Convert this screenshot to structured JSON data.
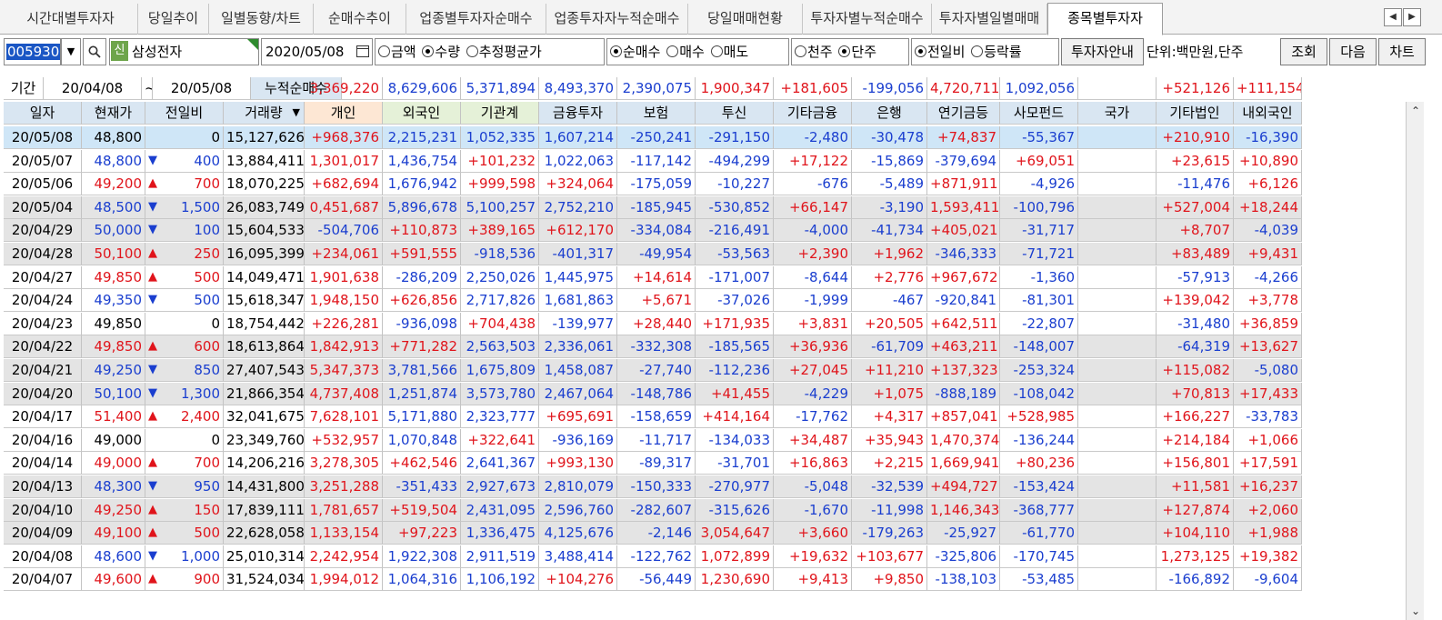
{
  "tabs": [
    "시간대별투자자",
    "당일추이",
    "일별동향/차트",
    "순매수추이",
    "업종별투자자순매수",
    "업종투자자누적순매수",
    "당일매매현황",
    "투자자별누적순매수",
    "투자자별일별매매",
    "종목별투자자"
  ],
  "active_tab": "종목별투자자",
  "toolbar": {
    "code": "005930",
    "shin_badge": "신",
    "name": "삼성전자",
    "date": "2020/05/08",
    "radio_amount": [
      "금액",
      "수량",
      "추정평균가"
    ],
    "radio_trade": [
      "순매수",
      "매수",
      "매도"
    ],
    "radio_unit": [
      "천주",
      "단주"
    ],
    "radio_compare": [
      "전일비",
      "등락률"
    ],
    "investor_guide": "투자자안내",
    "unit_text": "단위:백만원,단주",
    "btn_query": "조회",
    "btn_next": "다음",
    "btn_chart": "차트"
  },
  "period": {
    "label": "기간",
    "from": "20/04/08",
    "tilde": "~",
    "to": "20/05/08",
    "cumulative_label": "누적순매수",
    "sums": [
      "3,369,220",
      "8,629,606",
      "5,371,894",
      "8,493,370",
      "2,390,075",
      "1,900,347",
      "+181,605",
      "-199,056",
      "4,720,711",
      "1,092,056",
      "",
      "+521,126",
      "+111,154"
    ]
  },
  "columns": [
    "일자",
    "현재가",
    "전일비",
    "거래량",
    "개인",
    "외국인",
    "기관계",
    "금융투자",
    "보험",
    "투신",
    "기타금융",
    "은행",
    "연기금등",
    "사모펀드",
    "국가",
    "기타법인",
    "내외국인"
  ],
  "rows": [
    [
      "20/05/08",
      "48,800",
      "",
      "0",
      "15,127,626",
      "+968,376",
      "2,215,231",
      "1,052,335",
      "1,607,214",
      "-250,241",
      "-291,150",
      "-2,480",
      "-30,478",
      "+74,837",
      "-55,367",
      "",
      "+210,910",
      "-16,390"
    ],
    [
      "20/05/07",
      "48,800",
      "▼",
      "400",
      "13,884,411",
      "1,301,017",
      "1,436,754",
      "+101,232",
      "1,022,063",
      "-117,142",
      "-494,299",
      "+17,122",
      "-15,869",
      "-379,694",
      "+69,051",
      "",
      "+23,615",
      "+10,890"
    ],
    [
      "20/05/06",
      "49,200",
      "▲",
      "700",
      "18,070,225",
      "+682,694",
      "1,676,942",
      "+999,598",
      "+324,064",
      "-175,059",
      "-10,227",
      "-676",
      "-5,489",
      "+871,911",
      "-4,926",
      "",
      "-11,476",
      "+6,126"
    ],
    [
      "20/05/04",
      "48,500",
      "▼",
      "1,500",
      "26,083,749",
      "0,451,687",
      "5,896,678",
      "5,100,257",
      "2,752,210",
      "-185,945",
      "-530,852",
      "+66,147",
      "-3,190",
      "1,593,411",
      "-100,796",
      "",
      "+527,004",
      "+18,244"
    ],
    [
      "20/04/29",
      "50,000",
      "▼",
      "100",
      "15,604,533",
      "-504,706",
      "+110,873",
      "+389,165",
      "+612,170",
      "-334,084",
      "-216,491",
      "-4,000",
      "-41,734",
      "+405,021",
      "-31,717",
      "",
      "+8,707",
      "-4,039"
    ],
    [
      "20/04/28",
      "50,100",
      "▲",
      "250",
      "16,095,399",
      "+234,061",
      "+591,555",
      "-918,536",
      "-401,317",
      "-49,954",
      "-53,563",
      "+2,390",
      "+1,962",
      "-346,333",
      "-71,721",
      "",
      "+83,489",
      "+9,431"
    ],
    [
      "20/04/27",
      "49,850",
      "▲",
      "500",
      "14,049,471",
      "1,901,638",
      "-286,209",
      "2,250,026",
      "1,445,975",
      "+14,614",
      "-171,007",
      "-8,644",
      "+2,776",
      "+967,672",
      "-1,360",
      "",
      "-57,913",
      "-4,266"
    ],
    [
      "20/04/24",
      "49,350",
      "▼",
      "500",
      "15,618,347",
      "1,948,150",
      "+626,856",
      "2,717,826",
      "1,681,863",
      "+5,671",
      "-37,026",
      "-1,999",
      "-467",
      "-920,841",
      "-81,301",
      "",
      "+139,042",
      "+3,778"
    ],
    [
      "20/04/23",
      "49,850",
      "",
      "0",
      "18,754,442",
      "+226,281",
      "-936,098",
      "+704,438",
      "-139,977",
      "+28,440",
      "+171,935",
      "+3,831",
      "+20,505",
      "+642,511",
      "-22,807",
      "",
      "-31,480",
      "+36,859"
    ],
    [
      "20/04/22",
      "49,850",
      "▲",
      "600",
      "18,613,864",
      "1,842,913",
      "+771,282",
      "2,563,503",
      "2,336,061",
      "-332,308",
      "-185,565",
      "+36,936",
      "-61,709",
      "+463,211",
      "-148,007",
      "",
      "-64,319",
      "+13,627"
    ],
    [
      "20/04/21",
      "49,250",
      "▼",
      "850",
      "27,407,543",
      "5,347,373",
      "3,781,566",
      "1,675,809",
      "1,458,087",
      "-27,740",
      "-112,236",
      "+27,045",
      "+11,210",
      "+137,323",
      "-253,324",
      "",
      "+115,082",
      "-5,080"
    ],
    [
      "20/04/20",
      "50,100",
      "▼",
      "1,300",
      "21,866,354",
      "4,737,408",
      "1,251,874",
      "3,573,780",
      "2,467,064",
      "-148,786",
      "+41,455",
      "-4,229",
      "+1,075",
      "-888,189",
      "-108,042",
      "",
      "+70,813",
      "+17,433"
    ],
    [
      "20/04/17",
      "51,400",
      "▲",
      "2,400",
      "32,041,675",
      "7,628,101",
      "5,171,880",
      "2,323,777",
      "+695,691",
      "-158,659",
      "+414,164",
      "-17,762",
      "+4,317",
      "+857,041",
      "+528,985",
      "",
      "+166,227",
      "-33,783"
    ],
    [
      "20/04/16",
      "49,000",
      "",
      "0",
      "23,349,760",
      "+532,957",
      "1,070,848",
      "+322,641",
      "-936,169",
      "-11,717",
      "-134,033",
      "+34,487",
      "+35,943",
      "1,470,374",
      "-136,244",
      "",
      "+214,184",
      "+1,066"
    ],
    [
      "20/04/14",
      "49,000",
      "▲",
      "700",
      "14,206,216",
      "3,278,305",
      "+462,546",
      "2,641,367",
      "+993,130",
      "-89,317",
      "-31,701",
      "+16,863",
      "+2,215",
      "1,669,941",
      "+80,236",
      "",
      "+156,801",
      "+17,591"
    ],
    [
      "20/04/13",
      "48,300",
      "▼",
      "950",
      "14,431,800",
      "3,251,288",
      "-351,433",
      "2,927,673",
      "2,810,079",
      "-150,333",
      "-270,977",
      "-5,048",
      "-32,539",
      "+494,727",
      "-153,424",
      "",
      "+11,581",
      "+16,237"
    ],
    [
      "20/04/10",
      "49,250",
      "▲",
      "150",
      "17,839,111",
      "1,781,657",
      "+519,504",
      "2,431,095",
      "2,596,760",
      "-282,607",
      "-315,626",
      "-1,670",
      "-11,998",
      "1,146,343",
      "-368,777",
      "",
      "+127,874",
      "+2,060"
    ],
    [
      "20/04/09",
      "49,100",
      "▲",
      "500",
      "22,628,058",
      "1,133,154",
      "+97,223",
      "1,336,475",
      "4,125,676",
      "-2,146",
      "3,054,647",
      "+3,660",
      "-179,263",
      "-25,927",
      "-61,770",
      "",
      "+104,110",
      "+1,988"
    ],
    [
      "20/04/08",
      "48,600",
      "▼",
      "1,000",
      "25,010,314",
      "2,242,954",
      "1,922,308",
      "2,911,519",
      "3,488,414",
      "-122,762",
      "1,072,899",
      "+19,632",
      "+103,677",
      "-325,806",
      "-170,745",
      "",
      "1,273,125",
      "+19,382"
    ],
    [
      "20/04/07",
      "49,600",
      "▲",
      "900",
      "31,524,034",
      "1,994,012",
      "1,064,316",
      "1,106,192",
      "+104,276",
      "-56,449",
      "1,230,690",
      "+9,413",
      "+9,850",
      "-138,103",
      "-53,485",
      "",
      "-166,892",
      "-9,604"
    ]
  ],
  "row_colors": {
    "sum": [
      "red",
      "blue",
      "blue",
      "blue",
      "blue",
      "red",
      "red",
      "blue",
      "red",
      "blue",
      "",
      "red",
      "red"
    ],
    "price": [
      "",
      "blue",
      "red",
      "blue",
      "blue",
      "red",
      "red",
      "blue",
      "",
      "red",
      "blue",
      "blue",
      "red",
      "",
      "red",
      "blue",
      "red",
      "red",
      "blue",
      "red"
    ]
  },
  "colors": {
    "red": "#e0141b",
    "blue": "#1a3ecf",
    "selected_row": "#cfe6f7",
    "gray_row": "#e4e4e4"
  }
}
